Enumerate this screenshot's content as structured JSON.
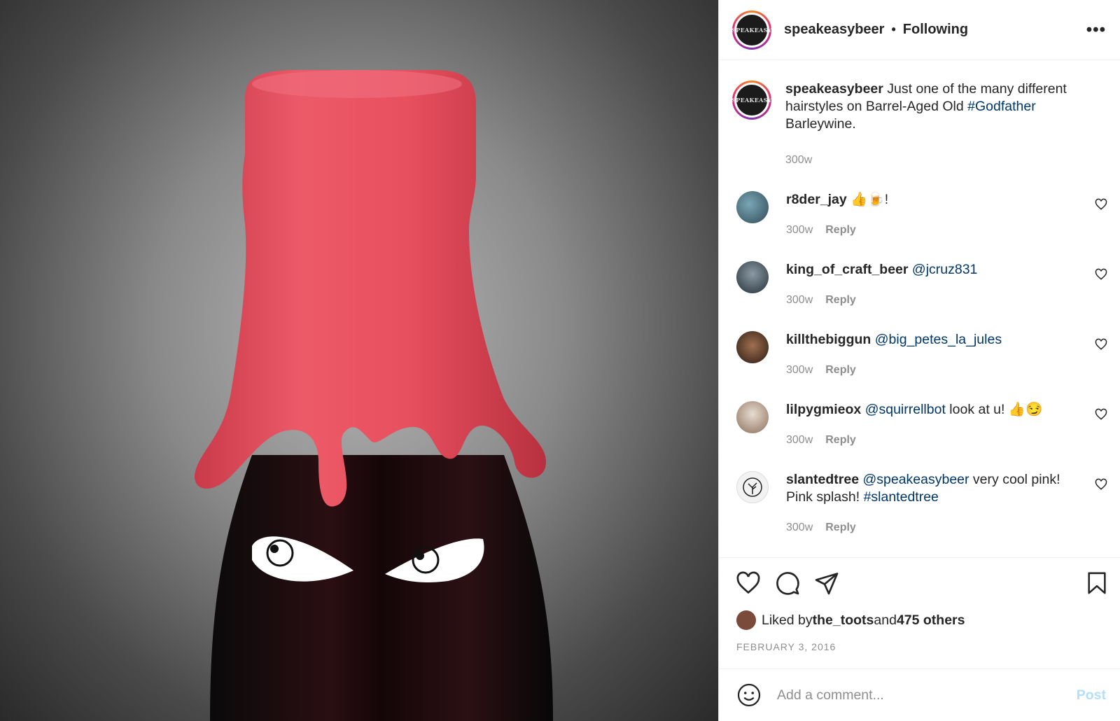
{
  "header": {
    "username": "speakeasybeer",
    "separator": "•",
    "follow_status": "Following",
    "avatar_text": "SPEAKEASY",
    "more_label": "•••"
  },
  "caption": {
    "username": "speakeasybeer",
    "text_before": " Just one of the many different hairstyles on Barrel-Aged Old ",
    "hashtag": "#Godfather",
    "text_after": " Barleywine.",
    "time": "300w"
  },
  "comments": [
    {
      "username": "r8der_jay",
      "mention": "",
      "text": " 👍🍺!",
      "time": "300w",
      "reply": "Reply",
      "avatar_color": "#3d6a80"
    },
    {
      "username": "king_of_craft_beer",
      "mention": " @jcruz831",
      "text": "",
      "time": "300w",
      "reply": "Reply",
      "avatar_color": "#5a6e7a"
    },
    {
      "username": "killthebiggun",
      "mention": " @big_petes_la_jules",
      "text": "",
      "time": "300w",
      "reply": "Reply",
      "avatar_color": "#3b2a20"
    },
    {
      "username": "lilpygmieox",
      "mention": " @squirrellbot",
      "text": " look at u! 👍😏",
      "time": "300w",
      "reply": "Reply",
      "avatar_color": "#c9b9a8"
    },
    {
      "username": "slantedtree",
      "mention": " @speakeasybeer",
      "text": " very cool pink! Pink splash! ",
      "hashtag": "#slantedtree",
      "time": "300w",
      "reply": "Reply",
      "avatar_color": "#f2f2f2"
    }
  ],
  "likes": {
    "prefix": "Liked by ",
    "user": "the_toots",
    "middle": " and ",
    "count": "475 others"
  },
  "date": "FEBRUARY 3, 2016",
  "add_comment": {
    "placeholder": "Add a comment...",
    "post_label": "Post"
  },
  "colors": {
    "wax": "#e8505e",
    "link": "#00376b",
    "post_disabled": "#b2dffc"
  }
}
